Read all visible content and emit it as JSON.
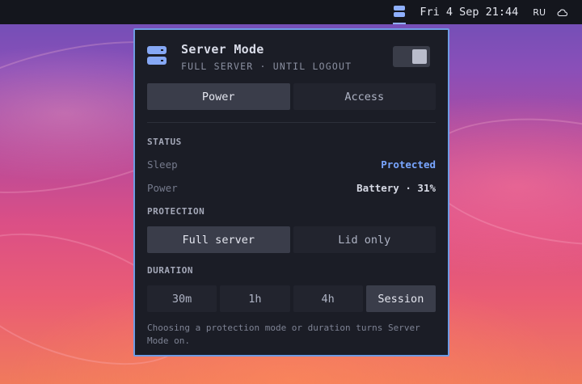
{
  "menubar": {
    "clock": "Fri 4 Sep 21:44",
    "lang": "RU",
    "server_icon": "server-icon",
    "cloud_icon": "cloud-icon"
  },
  "panel": {
    "title": "Server Mode",
    "subtitle": "FULL SERVER · UNTIL LOGOUT",
    "toggle_on": true,
    "tabs": [
      {
        "label": "Power",
        "active": true
      },
      {
        "label": "Access",
        "active": false
      }
    ],
    "status": {
      "label": "STATUS",
      "rows": [
        {
          "key": "Sleep",
          "value": "Protected"
        },
        {
          "key": "Power",
          "value": "Battery · 31%"
        }
      ]
    },
    "protection": {
      "label": "PROTECTION",
      "options": [
        {
          "label": "Full server",
          "active": true
        },
        {
          "label": "Lid only",
          "active": false
        }
      ]
    },
    "duration": {
      "label": "DURATION",
      "options": [
        {
          "label": "30m",
          "active": false
        },
        {
          "label": "1h",
          "active": false
        },
        {
          "label": "4h",
          "active": false
        },
        {
          "label": "Session",
          "active": true
        }
      ]
    },
    "note": "Choosing a protection mode or duration turns Server Mode on."
  },
  "colors": {
    "accent": "#79a6ff",
    "panel_bg": "#1b1d26",
    "panel_border": "#6f9be3",
    "active_button": "#3a3d4a"
  }
}
